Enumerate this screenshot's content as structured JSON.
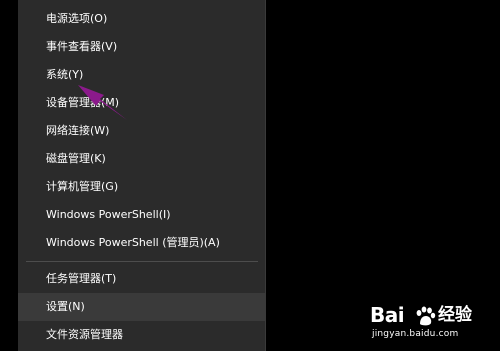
{
  "menu": {
    "items": [
      {
        "label": "电源选项(O)"
      },
      {
        "label": "事件查看器(V)"
      },
      {
        "label": "系统(Y)"
      },
      {
        "label": "设备管理器(M)"
      },
      {
        "label": "网络连接(W)"
      },
      {
        "label": "磁盘管理(K)"
      },
      {
        "label": "计算机管理(G)"
      },
      {
        "label": "Windows PowerShell(I)"
      },
      {
        "label": "Windows PowerShell (管理员)(A)"
      },
      {
        "label": "任务管理器(T)"
      },
      {
        "label": "设置(N)"
      },
      {
        "label": "文件资源管理器"
      }
    ],
    "highlighted_item": "设置(N)"
  },
  "annotation": {
    "arrow_color": "#8b1a8b",
    "points_to": "系统(Y)"
  },
  "watermark": {
    "brand_prefix": "Bai",
    "brand_suffix": "经验",
    "url": "jingyan.baidu.com"
  }
}
